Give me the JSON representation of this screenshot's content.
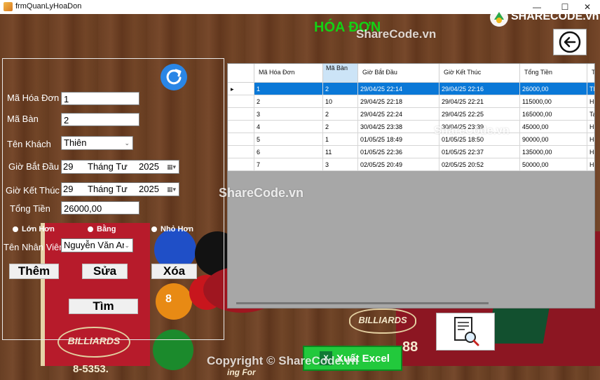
{
  "window": {
    "title": "frmQuanLyHoaDon",
    "minimize": "—",
    "maximize": "☐",
    "close": "✕"
  },
  "header": {
    "title": "HÓA ĐƠN"
  },
  "form": {
    "ma_hoa_don": {
      "label": "Mã Hóa Đơn",
      "value": "1"
    },
    "ma_ban": {
      "label": "Mã Bàn",
      "value": "2"
    },
    "ten_khach": {
      "label": "Tên Khách",
      "value": "Thiên"
    },
    "gio_bat_dau": {
      "label": "Giờ Bắt Đầu",
      "day": "29",
      "month": "Tháng Tư",
      "year": "2025"
    },
    "gio_ket_thuc": {
      "label": "Giờ Kết Thúc",
      "day": "29",
      "month": "Tháng Tư",
      "year": "2025"
    },
    "tong_tien": {
      "label": "Tổng Tiền",
      "value": "26000,00"
    },
    "radios": [
      "Lớn Hơn",
      "Bằng",
      "Nhỏ Hơn"
    ],
    "ten_nhan_vien": {
      "label": "Tên Nhân Viên",
      "value": "Nguyễn Văn An"
    }
  },
  "buttons": {
    "them": "Thêm",
    "sua": "Sửa",
    "xoa": "Xóa",
    "tim": "Tìm",
    "excel": "Xuất Excel"
  },
  "grid": {
    "columns": [
      "Mã Hóa Đơn",
      "Mã Bàn",
      "Giờ Bắt Đầu",
      "Giờ Kết Thúc",
      "Tổng Tiền",
      "T"
    ],
    "rows": [
      [
        "1",
        "2",
        "29/04/25 22:14",
        "29/04/25 22:16",
        "26000,00",
        "Th"
      ],
      [
        "2",
        "10",
        "29/04/25 22:18",
        "29/04/25 22:21",
        "115000,00",
        "Hu"
      ],
      [
        "3",
        "2",
        "29/04/25 22:24",
        "29/04/25 22:25",
        "165000,00",
        "Ta"
      ],
      [
        "4",
        "2",
        "30/04/25 23:38",
        "30/04/25 23:39",
        "45000,00",
        "Hu"
      ],
      [
        "5",
        "1",
        "01/05/25 18:49",
        "01/05/25 18:50",
        "90000,00",
        "Ha"
      ],
      [
        "6",
        "11",
        "01/05/25 22:36",
        "01/05/25 22:37",
        "135000,00",
        "Ha"
      ],
      [
        "7",
        "3",
        "02/05/25 20:49",
        "02/05/25 20:52",
        "50000,00",
        "Ha"
      ]
    ],
    "selected_row": 0,
    "row_indicator": "▸"
  },
  "decor": {
    "badge_left": "BILLIARDS",
    "badge_right": "BILLIARDS",
    "number": "88",
    "phone": "8-5353.",
    "sign_text": "ing For",
    "ball_number": "8"
  },
  "watermarks": {
    "logo_text": "SHARECODE.vn",
    "top": "ShareCode.vn",
    "grid": "ShareCode.vn",
    "middle": "ShareCode.vn",
    "bottom": "Copyright © ShareCode.vn"
  },
  "colors": {
    "title_green": "#14d114",
    "selection_blue": "#0a78d7",
    "refresh_blue": "#2a86e6",
    "excel_green": "#22c93c"
  },
  "icons": {
    "refresh": "refresh-icon",
    "back": "arrow-left-circle-icon",
    "search_document": "document-search-icon",
    "excel": "excel-icon"
  }
}
